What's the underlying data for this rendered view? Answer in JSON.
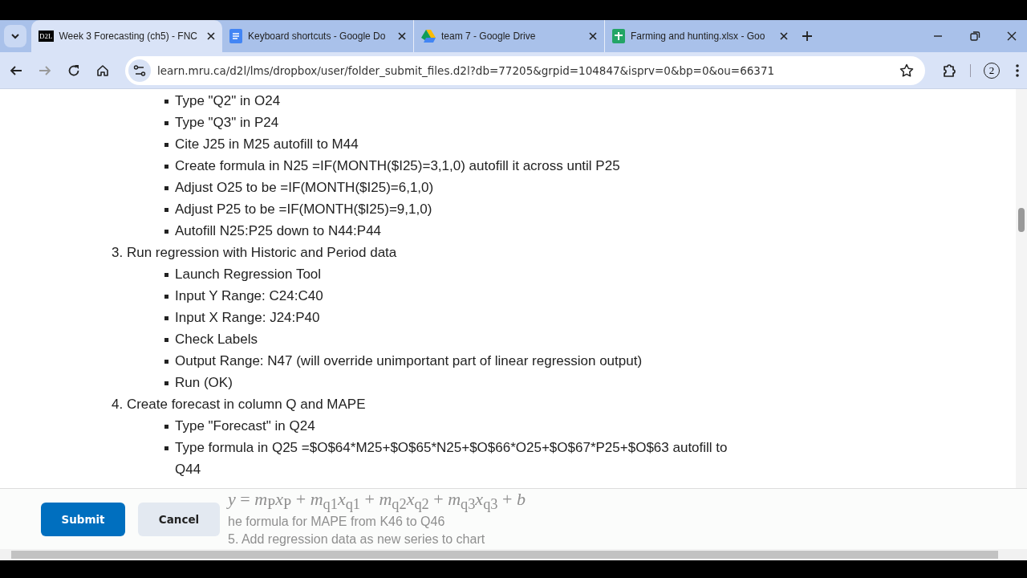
{
  "tabs": [
    {
      "title": "Week 3 Forecasting (ch5) - FNC",
      "kind": "d2l",
      "icon_text": "D2L",
      "selected": true
    },
    {
      "title": "Keyboard shortcuts - Google Do",
      "kind": "docs",
      "selected": false
    },
    {
      "title": "team 7 - Google Drive",
      "kind": "drive",
      "selected": false
    },
    {
      "title": "Farming and hunting.xlsx - Goo",
      "kind": "sheets",
      "selected": false
    }
  ],
  "address_bar": {
    "url": "learn.mru.ca/d2l/lms/dropbox/user/folder_submit_files.d2l?db=77205&grpid=104847&isprv=0&bp=0&ou=66371"
  },
  "profile_badge": "2",
  "content": [
    {
      "kind": "bullet",
      "text": "Type \"Q2\" in O24"
    },
    {
      "kind": "bullet",
      "text": "Type \"Q3\" in P24"
    },
    {
      "kind": "bullet",
      "text": "Cite J25 in M25 autofill to M44"
    },
    {
      "kind": "bullet",
      "text": "Create formula in N25 =IF(MONTH($I25)=3,1,0) autofill it across until P25"
    },
    {
      "kind": "bullet",
      "text": "Adjust O25 to be =IF(MONTH($I25)=6,1,0)"
    },
    {
      "kind": "bullet",
      "text": "Adjust P25 to be =IF(MONTH($I25)=9,1,0)"
    },
    {
      "kind": "bullet",
      "text": "Autofill N25:P25 down to N44:P44"
    },
    {
      "kind": "step",
      "text": "3. Run regression with Historic and Period data"
    },
    {
      "kind": "bullet",
      "text": "Launch Regression Tool"
    },
    {
      "kind": "bullet",
      "text": "Input Y Range: C24:C40"
    },
    {
      "kind": "bullet",
      "text": "Input X Range: J24:P40"
    },
    {
      "kind": "bullet",
      "text": "Check Labels"
    },
    {
      "kind": "bullet",
      "text": "Output Range: N47 (will override unimportant part of linear regression output)"
    },
    {
      "kind": "bullet",
      "text": "Run (OK)"
    },
    {
      "kind": "step",
      "text": "4. Create forecast in column Q and MAPE"
    },
    {
      "kind": "bullet",
      "text": "Type \"Forecast\" in Q24"
    },
    {
      "kind": "bullet",
      "text": "Type formula in Q25 =$O$64*M25+$O$65*N25+$O$66*O25+$O$67*P25+$O$63 autofill to Q44"
    }
  ],
  "behind_footer": {
    "formula": "*y* = *m*$_{P}$*x*$_{P}$ + *m*$_{q1}$*x*$_{q1}$ + *m*$_{q2}$*x*$_{q2}$ + *m*$_{q3}$*x*$_{q3}$ + *b*",
    "mape_line": "he formula for MAPE from K46 to Q46",
    "next_step": "5. Add regression data as new series to chart"
  },
  "buttons": [
    {
      "label": "Submit",
      "kind": "primary"
    },
    {
      "label": "Cancel",
      "kind": "secondary"
    }
  ]
}
